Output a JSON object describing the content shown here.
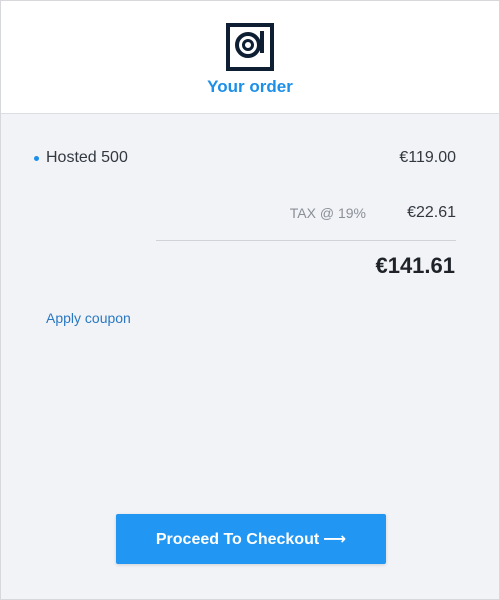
{
  "header": {
    "logo_icon": "target-square-logo",
    "title": "Your order"
  },
  "order": {
    "items": [
      {
        "name": "Hosted 500",
        "price": "€119.00"
      }
    ],
    "tax_label": "TAX @ 19%",
    "tax_value": "€22.61",
    "total": "€141.61"
  },
  "coupon": {
    "link_label": "Apply coupon"
  },
  "checkout": {
    "button_label": "Proceed To Checkout",
    "arrow_icon": "long-arrow-right-icon",
    "arrow_glyph": "⟶"
  },
  "colors": {
    "accent": "#1c8fe8",
    "button": "#2196f3",
    "background": "#f2f3f7"
  }
}
